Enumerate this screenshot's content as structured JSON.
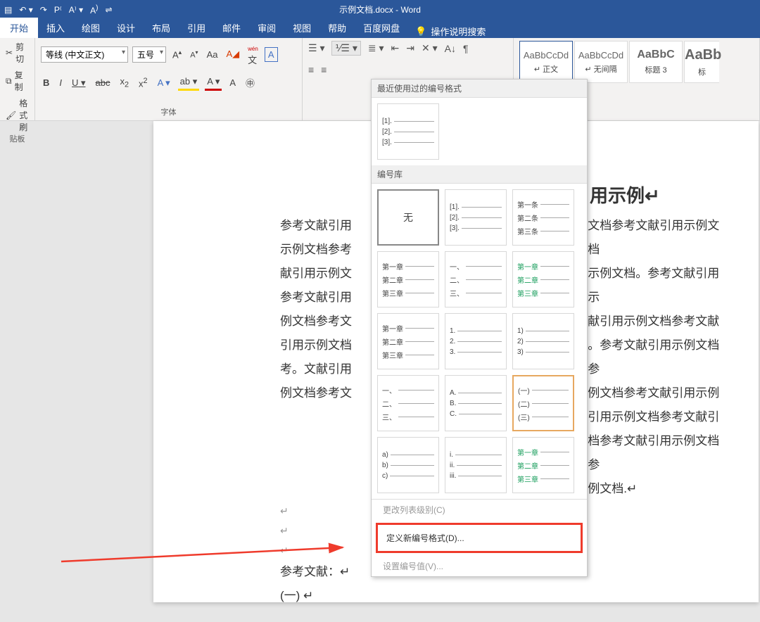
{
  "title": "示例文档.docx - Word",
  "tabs": [
    "开始",
    "插入",
    "绘图",
    "设计",
    "布局",
    "引用",
    "邮件",
    "审阅",
    "视图",
    "帮助",
    "百度网盘"
  ],
  "active_tab": 0,
  "tell_me": "操作说明搜索",
  "clipboard": {
    "cut": "剪切",
    "copy": "复制",
    "painter": "格式刷",
    "label": "贴板"
  },
  "font": {
    "name": "等线 (中文正文)",
    "size": "五号",
    "a_large": "A",
    "a_small": "A",
    "aa": "Aa",
    "clear": "A",
    "bold": "B",
    "italic": "I",
    "underline": "U",
    "strike": "abc",
    "sub": "x",
    "sub2": "2",
    "sup": "x",
    "sup2": "2",
    "texteffect": "A",
    "highlight": "A",
    "fontcolor": "A",
    "circle": "A",
    "box": "A",
    "label": "字体",
    "pinyin": "wén",
    "pinyin2": "文"
  },
  "styles": {
    "s1_preview": "AaBbCcDd",
    "s1_name": "↵ 正文",
    "s2_preview": "AaBbCcDd",
    "s2_name": "↵ 无间隔",
    "s3_preview": "AaBbC",
    "s3_name": "标题 3",
    "s4_preview": "AaBb",
    "s4_name": "标"
  },
  "doc": {
    "heading_suffix": "用示例↵",
    "body_left": "参考文献引用\n示例文档参考\n献引用示例文\n参考文献引用\n例文档参考文\n引用示例文档\n考。文献引用\n例文档参考文",
    "body_right": "文档参考文献引用示例文档\n示例文档。参考文献引用示\n献引用示例文档参考文献\n。参考文献引用示例文档参\n例文档参考文献引用示例\n引用示例文档参考文献引\n档参考文献引用示例文档参\n例文档.↵",
    "ref_label": "参考文献：↵",
    "ref_item": "(一)  ↵"
  },
  "dropdown": {
    "recent_header": "最近使用过的编号格式",
    "lib_header": "编号库",
    "none": "无",
    "change_level": "更改列表级别(C)",
    "define_new": "定义新编号格式(D)...",
    "set_value": "设置编号值(V)...",
    "recent": [
      "[1].",
      "[2].",
      "[3]."
    ],
    "g1": [
      "[1].",
      "[2].",
      "[3]."
    ],
    "g2": [
      "第一条",
      "第二条",
      "第三条"
    ],
    "g3": [
      "第一章",
      "第二章",
      "第三章"
    ],
    "g4": [
      "一、",
      "二、",
      "三、"
    ],
    "g5": [
      "第一章",
      "第二章",
      "第三章"
    ],
    "g6": [
      "第一章",
      "第二章",
      "第三章"
    ],
    "g7": [
      "1.",
      "2.",
      "3."
    ],
    "g8": [
      "1)",
      "2)",
      "3)"
    ],
    "g9": [
      "一、",
      "二、",
      "三、"
    ],
    "g10": [
      "A.",
      "B.",
      "C."
    ],
    "g11": [
      "(一)",
      "(二)",
      "(三)"
    ],
    "g12": [
      "a)",
      "b)",
      "c)"
    ],
    "g13": [
      "i.",
      "ii.",
      "iii."
    ],
    "g14": [
      "第一章",
      "第二章",
      "第三章"
    ]
  }
}
